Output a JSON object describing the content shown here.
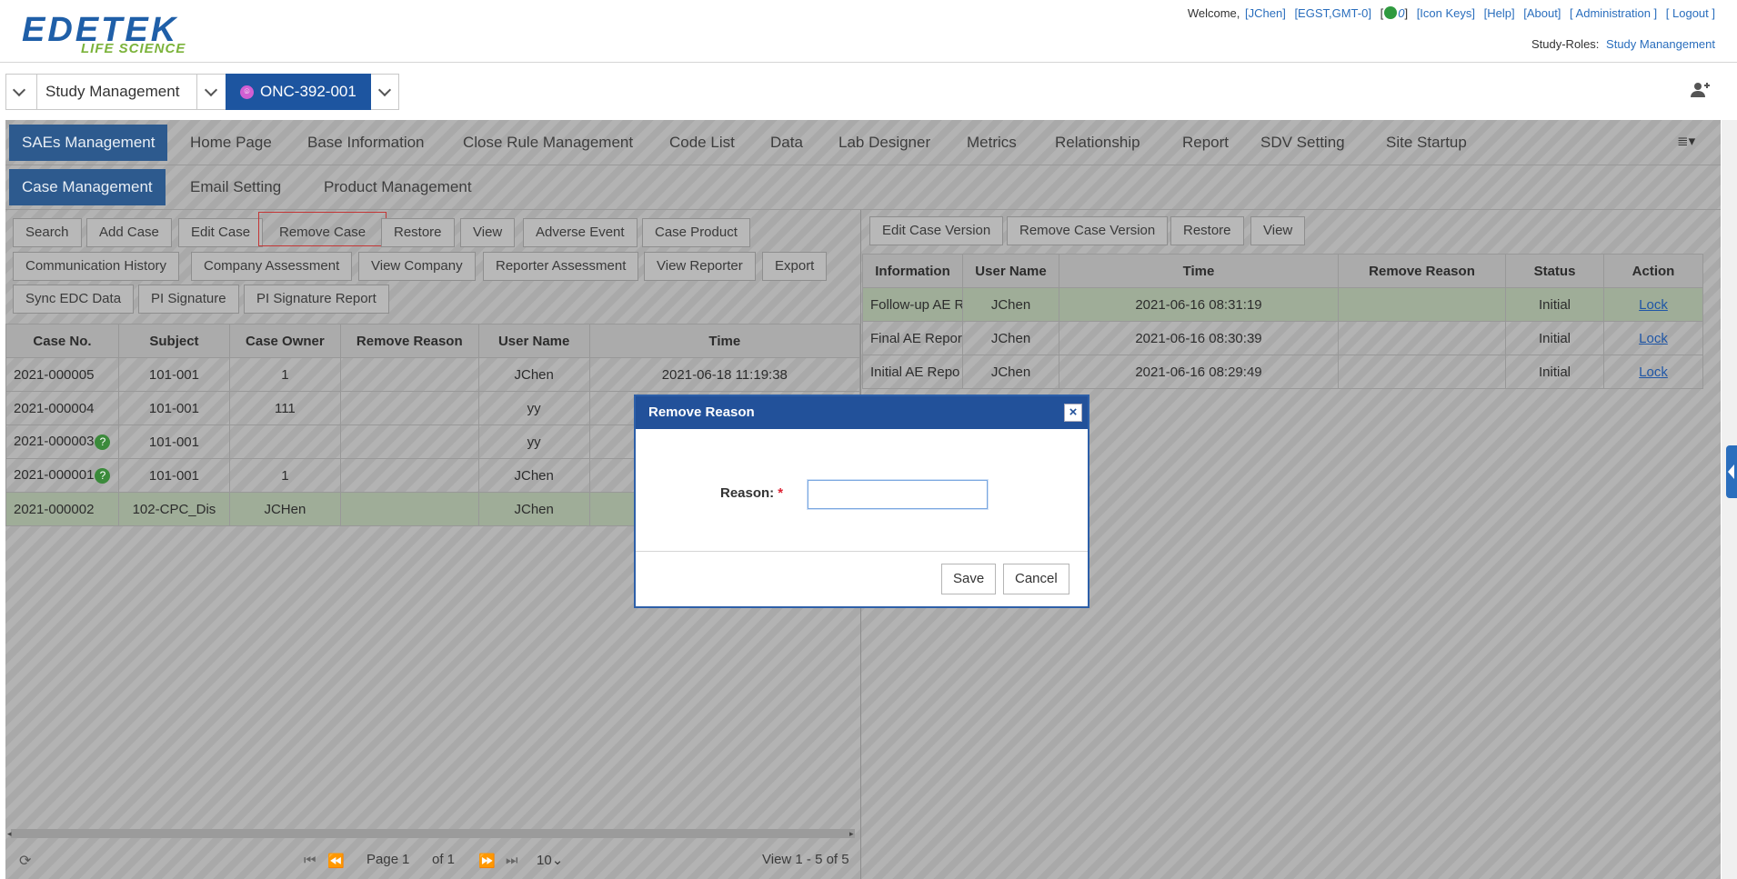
{
  "brand": {
    "line1": "EDETEK",
    "line2": "LIFE SCIENCE"
  },
  "header": {
    "welcome": "Welcome,",
    "user": "[JChen]",
    "timezone": "[EGST,GMT-0]",
    "messages_count": "0",
    "links": [
      "[Icon Keys]",
      "[Help]",
      "[About]",
      "[ Administration ]",
      "[ Logout ]"
    ],
    "study_roles_label": "Study-Roles:",
    "study_roles_value": "Study Manangement"
  },
  "study_bar": {
    "module": "Study Management",
    "protocol": "ONC-392-001"
  },
  "main_tabs": [
    "SAEs Management",
    "Home Page",
    "Base Information",
    "Close Rule Management",
    "Code List",
    "Data",
    "Lab Designer",
    "Metrics",
    "Relationship",
    "Report",
    "SDV Setting",
    "Site Startup"
  ],
  "sub_tabs": [
    "Case Management",
    "Email Setting",
    "Product Management"
  ],
  "left_toolbar": {
    "row1": [
      "Search",
      "Add Case",
      "Edit Case",
      "Remove Case",
      "Restore",
      "View",
      "Adverse Event",
      "Case Product"
    ],
    "row2": [
      "Communication History",
      "Company Assessment",
      "View Company",
      "Reporter Assessment",
      "View Reporter",
      "Export"
    ],
    "row3": [
      "Sync EDC Data",
      "PI Signature",
      "PI Signature Report"
    ]
  },
  "case_table": {
    "columns": [
      "Case No.",
      "Subject",
      "Case Owner",
      "Remove Reason",
      "User Name",
      "Time"
    ],
    "rows": [
      {
        "case_no": "2021-000005",
        "subject": "101-001",
        "owner": "1",
        "reason": "",
        "user": "JChen",
        "time": "2021-06-18 11:19:38"
      },
      {
        "case_no": "2021-000004",
        "subject": "101-001",
        "owner": "111",
        "reason": "",
        "user": "yy",
        "time": ""
      },
      {
        "case_no": "2021-000003",
        "subject": "101-001",
        "owner": "",
        "reason": "",
        "user": "yy",
        "time": ""
      },
      {
        "case_no": "2021-000001",
        "subject": "101-001",
        "owner": "1",
        "reason": "",
        "user": "JChen",
        "time": ""
      },
      {
        "case_no": "2021-000002",
        "subject": "102-CPC_Dis",
        "owner": "JCHen",
        "reason": "",
        "user": "JChen",
        "time": ""
      }
    ]
  },
  "pager": {
    "page_label": "Page",
    "page": "1",
    "of_label": "of 1",
    "page_size": "10",
    "summary": "View 1 - 5 of 5"
  },
  "right_toolbar": [
    "Edit Case Version",
    "Remove Case Version",
    "Restore",
    "View"
  ],
  "version_table": {
    "columns": [
      "Information",
      "User Name",
      "Time",
      "Remove Reason",
      "Status",
      "Action"
    ],
    "rows": [
      {
        "info": "Follow-up AE R",
        "user": "JChen",
        "time": "2021-06-16 08:31:19",
        "reason": "",
        "status": "Initial",
        "action": "Lock"
      },
      {
        "info": "Final AE Report",
        "user": "JChen",
        "time": "2021-06-16 08:30:39",
        "reason": "",
        "status": "Initial",
        "action": "Lock"
      },
      {
        "info": "Initial AE Repo",
        "user": "JChen",
        "time": "2021-06-16 08:29:49",
        "reason": "",
        "status": "Initial",
        "action": "Lock"
      }
    ]
  },
  "modal": {
    "title": "Remove Reason",
    "close": "×",
    "label": "Reason:",
    "required_mark": "*",
    "value": "",
    "save": "Save",
    "cancel": "Cancel"
  },
  "colors": {
    "primary": "#22519a",
    "active_tab": "#2d5a8e",
    "selected_row": "#9fad98",
    "highlight_border": "#c43535"
  }
}
